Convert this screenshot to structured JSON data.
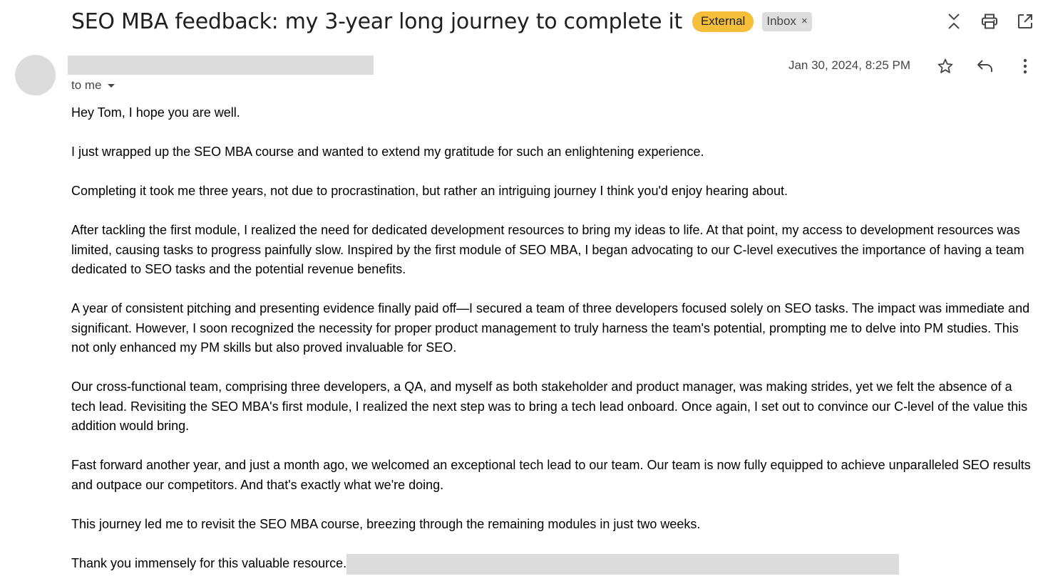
{
  "email": {
    "subject": "SEO MBA feedback: my 3-year long journey to complete it",
    "labels": {
      "external": "External",
      "inbox": "Inbox",
      "inbox_remove": "×"
    },
    "recipient": "to me",
    "date": "Jan 30, 2024, 8:25 PM",
    "body": {
      "greeting": "Hey Tom, I hope you are well.",
      "p1": "I just wrapped up the SEO MBA course and wanted to extend my gratitude for such an enlightening experience.",
      "p2": "Completing it took me three years, not due to procrastination, but rather an intriguing journey I think you'd enjoy hearing about.",
      "p3": "After tackling the first module, I realized the need for dedicated development resources to bring my ideas to life. At that point, my access to development resources was limited, causing tasks to progress painfully slow. Inspired by the first module of SEO MBA, I began advocating to our C-level executives the importance of having a team dedicated to SEO tasks and the potential revenue benefits.",
      "p4": "A year of consistent pitching and presenting evidence finally paid off—I secured a team of three developers focused solely on SEO tasks. The impact was immediate and significant. However, I soon recognized the necessity for proper product management to truly harness the team's potential, prompting me to delve into PM studies. This not only enhanced my PM skills but also proved invaluable for SEO.",
      "p5": "Our cross-functional team, comprising three developers, a QA, and myself as both stakeholder and product manager, was making strides, yet we felt the absence of a tech lead. Revisiting the SEO MBA's first module, I realized the next step was to bring a tech lead onboard. Once again, I set out to convince our C-level of the value this addition would bring.",
      "p6": "Fast forward another year, and just a month ago, we welcomed an exceptional tech lead to our team. Our team is now fully equipped to achieve unparalleled SEO results and outpace our competitors. And that's exactly what we're doing.",
      "p7": "This journey led me to revisit the SEO MBA course, breezing through the remaining modules in just two weeks.",
      "closing": "Thank you immensely for this valuable resource."
    }
  },
  "icons": {
    "top": [
      "collapse-icon",
      "print-icon",
      "open-in-new-window-icon"
    ],
    "message": [
      "star-icon",
      "reply-icon",
      "more-vert-icon"
    ]
  },
  "colors": {
    "external_badge": "#f6bf3b",
    "inbox_badge": "#dddddd",
    "redaction": "#dcdcdc"
  }
}
